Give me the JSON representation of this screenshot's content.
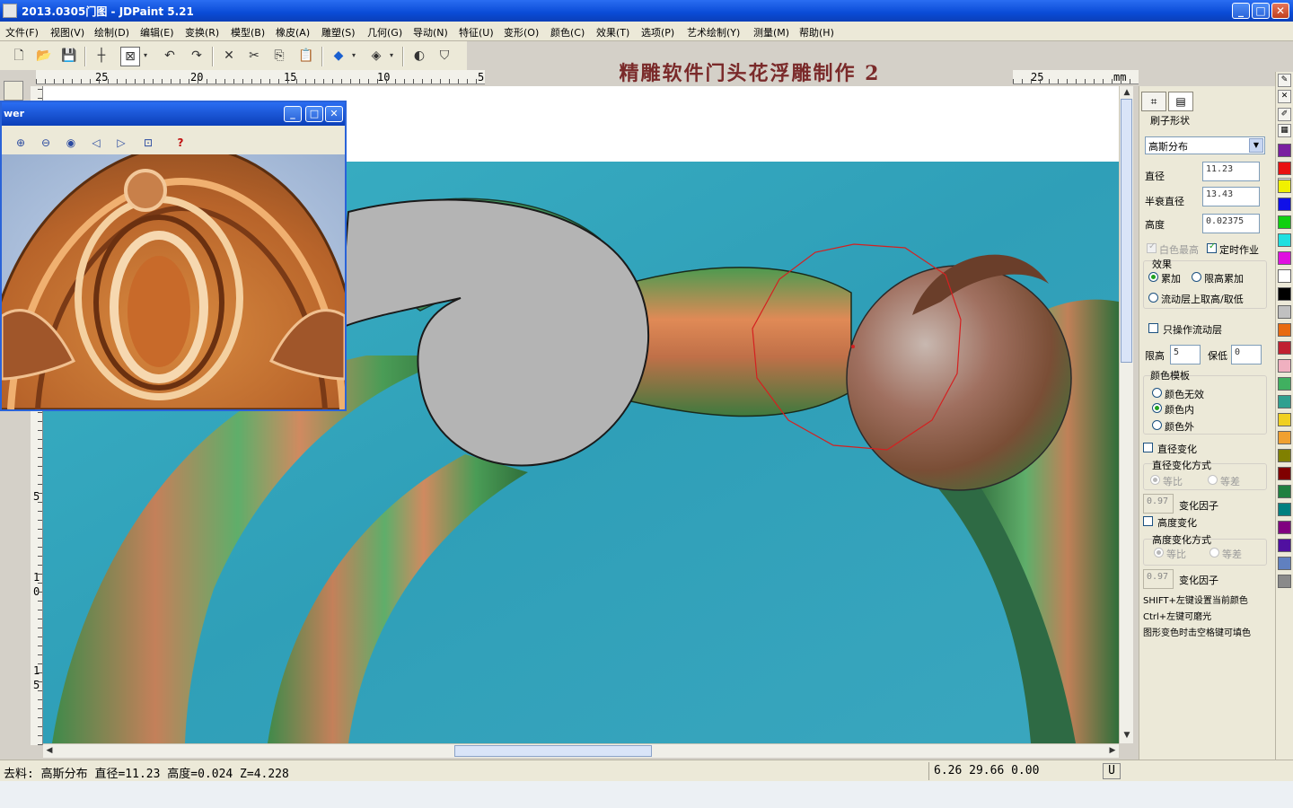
{
  "window": {
    "title": "2013.0305门图 - JDPaint 5.21",
    "minimize": "_",
    "maximize": "□",
    "close": "✕"
  },
  "menu": [
    "文件(F)",
    "视图(V)",
    "绘制(D)",
    "编辑(E)",
    "变换(R)",
    "模型(B)",
    "橡皮(A)",
    "雕塑(S)",
    "几何(G)",
    "导动(N)",
    "特征(U)",
    "变形(O)",
    "颜色(C)",
    "效果(T)",
    "选项(P)",
    "艺术绘制(Y)",
    "测量(M)",
    "帮助(H)"
  ],
  "heading": "精雕软件门头花浮雕制作 2",
  "ruler": {
    "top_labels": [
      "25",
      "20",
      "15",
      "10",
      "5"
    ],
    "right_label": "25",
    "unit": "mm",
    "left_labels": [
      "5",
      "1",
      "0",
      "1",
      "5"
    ]
  },
  "viewer": {
    "title": "wer",
    "help": "?"
  },
  "panel": {
    "tab1": "⌗",
    "tab2": "▤",
    "brush_shape_label": "刷子形状",
    "brush_shape_value": "高斯分布",
    "diameter_label": "直径",
    "diameter_value": "11.23",
    "half_decay_label": "半衰直径",
    "half_decay_value": "13.43",
    "height_label": "高度",
    "height_value": "0.02375",
    "white_max_label": "白色最高",
    "timed_label": "定时作业",
    "effect_label": "效果",
    "accumulate_label": "累加",
    "limit_accumulate_label": "限高累加",
    "flow_layer_label": "流动层上取高/取低",
    "only_flow_label": "只操作流动层",
    "limit_high_label": "限高",
    "limit_high_value": "5",
    "keep_low_label": "保低",
    "keep_low_value": "0",
    "color_template_label": "颜色模板",
    "color_none_label": "颜色无效",
    "color_inside_label": "颜色内",
    "color_outside_label": "颜色外",
    "diameter_change_label": "直径变化",
    "diameter_change_mode_label": "直径变化方式",
    "ratio_label": "等比",
    "equal_diff_label": "等差",
    "factor1_value": "0.97",
    "factor_label": "变化因子",
    "height_change_label": "高度变化",
    "height_change_mode_label": "高度变化方式",
    "factor2_value": "0.97",
    "hint1": "SHIFT+左键设置当前颜色",
    "hint2": "Ctrl+左键可磨光",
    "hint3": "图形变色时击空格键可填色"
  },
  "palette": [
    "#7a1fa0",
    "#e81010",
    "#f0f000",
    "#1010e8",
    "#10d010",
    "#20e0e0",
    "#e010e0",
    "#ffffff",
    "#000000",
    "#c0c0c0",
    "#e86a10",
    "#c02030",
    "#f0b0c0",
    "#40b060",
    "#30a090",
    "#f0d020",
    "#f0a030",
    "#808000",
    "#800000",
    "#208040",
    "#008080",
    "#800080",
    "#5010a0",
    "#6080c0",
    "#8a8a8a"
  ],
  "status": {
    "left": "去料: 高斯分布  直径=11.23  高度=0.024  Z=4.228",
    "coords": "6.26 29.66 0.00",
    "u": "U"
  }
}
